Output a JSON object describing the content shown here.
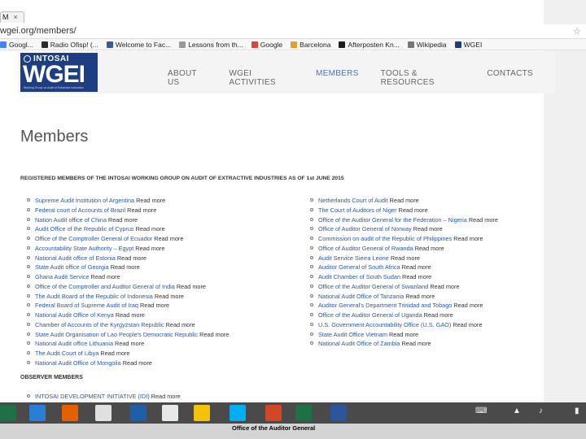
{
  "browser": {
    "tab_title": "M",
    "tab_close": "×",
    "url": "wgei.org/members/",
    "bookmarks": [
      {
        "label": "Googl...",
        "color": "#4285f4"
      },
      {
        "label": "Radio Ofisp! (...",
        "color": "#2b2b2b"
      },
      {
        "label": "Welcome to Fac...",
        "color": "#3b5998"
      },
      {
        "label": "Lessons from th...",
        "color": "#999999"
      },
      {
        "label": "Google",
        "color": "#db4437"
      },
      {
        "label": "Barcelona",
        "color": "#e0a030"
      },
      {
        "label": "Afterposten Kn...",
        "color": "#1c1c1c"
      },
      {
        "label": "Wikipedia",
        "color": "#777777"
      },
      {
        "label": "WGEI",
        "color": "#1d3e82"
      }
    ]
  },
  "site": {
    "logo_top": "INTOSAI",
    "logo_main": "WGEI",
    "logo_sub": "Working Group on Audit of Extractive Industries",
    "nav": [
      {
        "label": "ABOUT US",
        "active": false
      },
      {
        "label": "WGEI ACTIVITIES",
        "active": false
      },
      {
        "label": "MEMBERS",
        "active": true
      },
      {
        "label": "TOOLS & RESOURCES",
        "active": false
      },
      {
        "label": "CONTACTS",
        "active": false
      }
    ]
  },
  "main": {
    "title": "Members",
    "registered_heading": "REGISTERED MEMBERS OF THE INTOSAI WORKING GROUP ON AUDIT OF EXTRACTIVE INDUSTRIES AS OF 1st JUNE 2015",
    "read_more": "Read more",
    "left_members": [
      "Supreme Audit Institution of Argentina",
      "Federal court of Accounts of Brazil",
      "Nation Audit office of China",
      "Audit Office of the Republic of Cyprus",
      "Office of the Comptroller General of Ecuador",
      "Accountability State Authority – Egypt",
      "National Audit office of Estonia",
      "State Audit office of Georgia",
      "Ghana Audit Service",
      "Office of the Comptroller and Auditor General of India",
      "The Audit Board of the Republic of Indonesia",
      "Federal Board of Supreme Audit of Iraq",
      "National Audit Office of Kenya",
      "Chamber of Accounts of the Kyrgyzstan Republic",
      "State Audit Organisation of Lao People's Democratic Republic",
      "National Audit office Lithuania",
      "The Audit Court of Libya",
      "National Audit Office of Mongolia"
    ],
    "right_members": [
      "Netherlands Court of Audit",
      "The Court of Auditors of Niger",
      "Office of the Auditor General for the Federation – Nigeria",
      "Office of Auditor General of Norway",
      "Commission on audit of the Republic of Philippines",
      "Office of Auditor General of Rwanda",
      "Audit Service Sierra Leone",
      "Auditor General of South Africa",
      "Audit Chamber of South Sudan",
      "Office of the Auditor General of Swaziland",
      "National Audit Office of Tanzania",
      "Auditor General's Department Trinidad and Tobago",
      "Office of the Auditor General of Uganda",
      "U.S. Government Accountability Office (U.S. GAO)",
      "State Audit Office Vietnam",
      "National Audit Office of Zambia"
    ],
    "observer_heading": "OBSERVER MEMBERS",
    "observer_members": [
      "INTOSAI DEVELOPMENT INITIATIVE (IDI)"
    ]
  },
  "taskbar": {
    "caption": "Office of the Auditor General",
    "apps": [
      {
        "name": "excel-tile",
        "color": "#1e7145"
      },
      {
        "name": "mail-tile",
        "color": "#2a7fd4"
      },
      {
        "name": "firefox",
        "color": "#e66000"
      },
      {
        "name": "adobe",
        "color": "#e0e0e0"
      },
      {
        "name": "monitor",
        "color": "#1f5fa8"
      },
      {
        "name": "home",
        "color": "#e8e8e8"
      },
      {
        "name": "chrome",
        "color": "#f4c20d"
      },
      {
        "name": "skype",
        "color": "#00aff0"
      },
      {
        "name": "powerpoint",
        "color": "#d24726"
      },
      {
        "name": "excel",
        "color": "#1e7145"
      },
      {
        "name": "word",
        "color": "#2b579a"
      }
    ]
  }
}
